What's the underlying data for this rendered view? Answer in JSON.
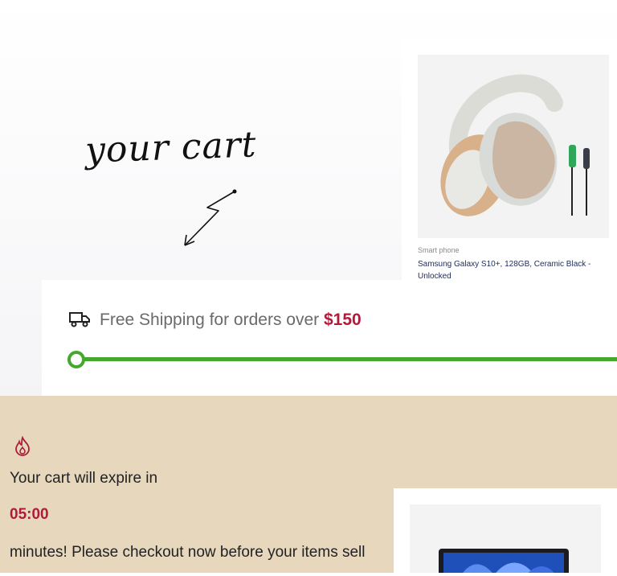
{
  "annotation": {
    "text": "your cart"
  },
  "product": {
    "category": "Smart phone",
    "name": "Samsung Galaxy S10+, 128GB, Ceramic Black - Unlocked",
    "image": "headphones-image"
  },
  "shipping": {
    "text": "Free Shipping for orders over ",
    "amount": "$150",
    "progress": 0,
    "icon": "truck-icon",
    "accent": "#44a82e"
  },
  "expire": {
    "icon": "flame-icon",
    "line1": "Your cart will expire in",
    "timer": "05:00",
    "line2": "minutes! Please checkout now before your items sell",
    "background": "#e6d7bd",
    "accent": "#b21a3c"
  },
  "product2": {
    "image": "laptop-image"
  }
}
